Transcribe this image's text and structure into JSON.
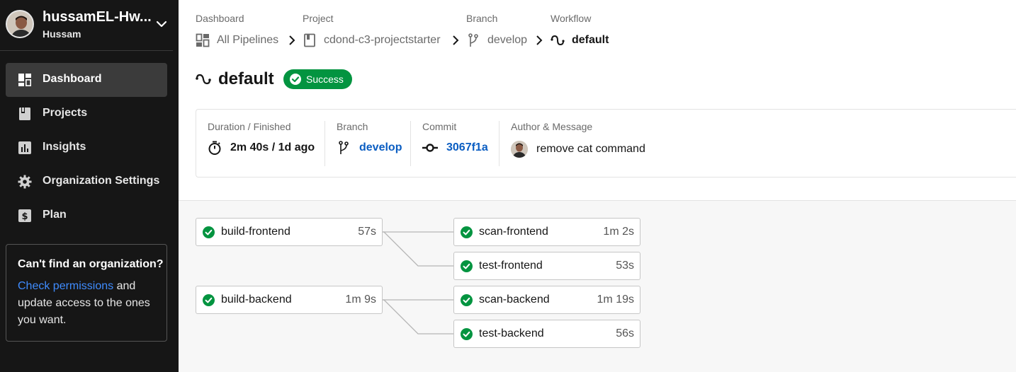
{
  "sidebar": {
    "org_name": "hussamEL-Hw...",
    "org_sub": "Hussam",
    "nav": [
      {
        "label": "Dashboard",
        "icon": "dashboard-icon",
        "active": true
      },
      {
        "label": "Projects",
        "icon": "book-icon",
        "active": false
      },
      {
        "label": "Insights",
        "icon": "chart-icon",
        "active": false
      },
      {
        "label": "Organization Settings",
        "icon": "gear-icon",
        "active": false
      },
      {
        "label": "Plan",
        "icon": "dollar-icon",
        "active": false
      }
    ],
    "help": {
      "title": "Can't find an organization?",
      "link": "Check permissions",
      "text": " and update access to the ones you want."
    }
  },
  "breadcrumb": {
    "labels": [
      "Dashboard",
      "Project",
      "Branch",
      "Workflow"
    ],
    "items": [
      "All Pipelines",
      "cdond-c3-projectstarter",
      "develop",
      "default"
    ]
  },
  "workflow": {
    "title": "default",
    "status": "Success",
    "status_color": "#039440"
  },
  "summary": {
    "duration_label": "Duration / Finished",
    "duration_value": "2m 40s / 1d ago",
    "branch_label": "Branch",
    "branch_value": "develop",
    "commit_label": "Commit",
    "commit_value": "3067f1a",
    "author_label": "Author & Message",
    "author_message": "remove cat command"
  },
  "jobs": [
    {
      "name": "build-frontend",
      "duration": "57s"
    },
    {
      "name": "scan-frontend",
      "duration": "1m 2s"
    },
    {
      "name": "test-frontend",
      "duration": "53s"
    },
    {
      "name": "build-backend",
      "duration": "1m 9s"
    },
    {
      "name": "scan-backend",
      "duration": "1m 19s"
    },
    {
      "name": "test-backend",
      "duration": "56s"
    }
  ],
  "colors": {
    "sidebar_bg": "#161616",
    "success": "#039440",
    "link": "#0a5dc2"
  }
}
